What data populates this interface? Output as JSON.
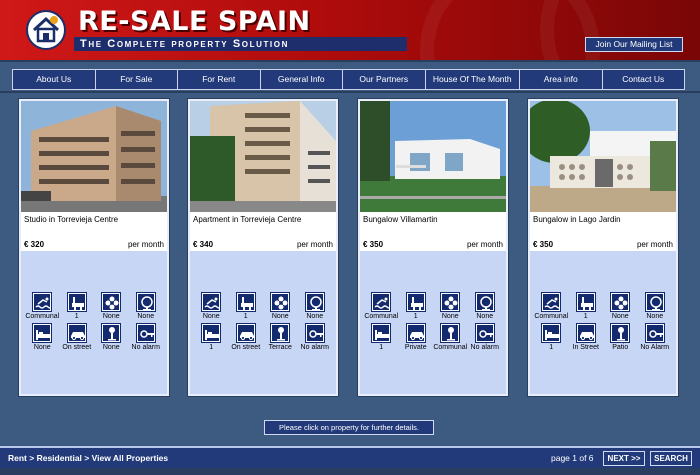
{
  "brand": {
    "title": "RE-SALE SPAIN",
    "tagline": "The Complete property Solution",
    "mailing_button": "Join Our Mailing List"
  },
  "nav": [
    {
      "label": "About Us"
    },
    {
      "label": "For Sale"
    },
    {
      "label": "For Rent"
    },
    {
      "label": "General Info"
    },
    {
      "label": "Our Partners"
    },
    {
      "label": "House Of The Month"
    },
    {
      "label": "Area info"
    },
    {
      "label": "Contact Us"
    }
  ],
  "properties": [
    {
      "title": "Studio in Torrevieja Centre",
      "price": "€ 320",
      "period": "per month",
      "features": [
        "Communal",
        "1",
        "None",
        "None",
        "None",
        "On street",
        "None",
        "No alarm"
      ]
    },
    {
      "title": "Apartment in Torrevieja Centre",
      "price": "€ 340",
      "period": "per month",
      "features": [
        "None",
        "1",
        "None",
        "None",
        "1",
        "On street",
        "Terrace",
        "No alarm"
      ]
    },
    {
      "title": "Bungalow Villamartin",
      "price": "€ 350",
      "period": "per month",
      "features": [
        "Communal",
        "1",
        "None",
        "None",
        "1",
        "Private",
        "Communal",
        "No alarm"
      ]
    },
    {
      "title": "Bungalow in Lago Jardin",
      "price": "€ 350",
      "period": "per month",
      "features": [
        "Communal",
        "1",
        "None",
        "None",
        "1",
        "In Street",
        "Patio",
        "No Alarm"
      ]
    }
  ],
  "feature_icons": [
    "pool-icon",
    "bathroom-icon",
    "garden-icon",
    "satellite-tv-icon",
    "bedroom-icon",
    "car-parking-icon",
    "terrace-icon",
    "alarm-key-icon"
  ],
  "click_hint": "Please click on property for further details.",
  "footer": {
    "breadcrumb": "Rent > Residential > View All Properties",
    "pager": "page 1 of 6",
    "next": "NEXT >>",
    "search": "SEARCH"
  }
}
